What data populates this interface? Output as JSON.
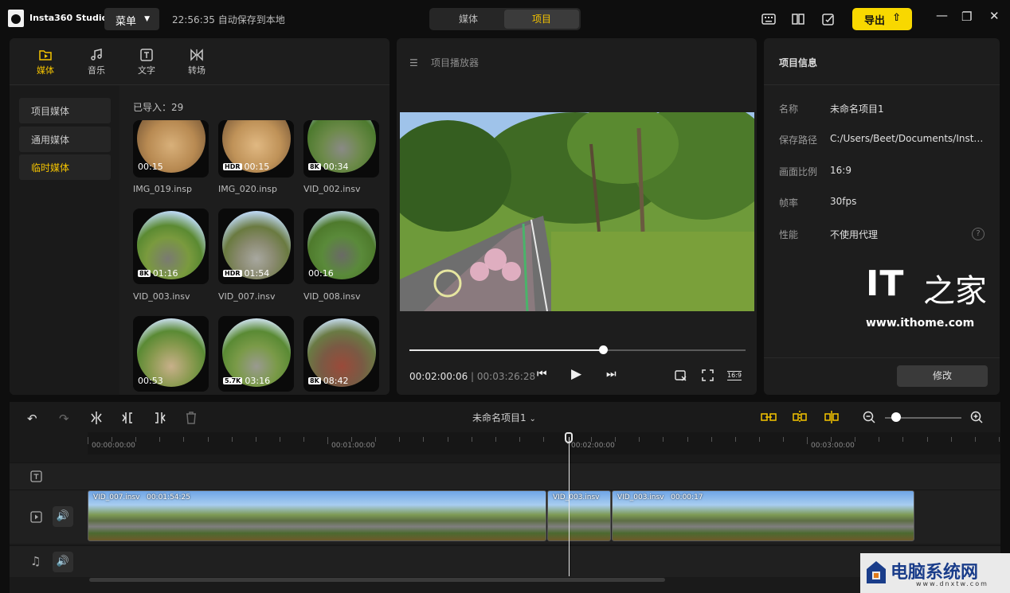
{
  "app": {
    "title": "Insta360 Studio",
    "menu_label": "菜单",
    "autosave": "22:56:35 自动保存到本地"
  },
  "top_toggle": {
    "media": "媒体",
    "project": "项目"
  },
  "toolbar": {
    "export_label": "导出"
  },
  "left_tabs": [
    {
      "label": "媒体",
      "icon": "folder-play-icon"
    },
    {
      "label": "音乐",
      "icon": "music-note-icon"
    },
    {
      "label": "文字",
      "icon": "text-icon"
    },
    {
      "label": "转场",
      "icon": "transition-icon"
    }
  ],
  "side_menu": [
    "项目媒体",
    "通用媒体",
    "临时媒体"
  ],
  "imported_label": "已导入：29",
  "media": [
    {
      "name": "IMG_019.insp",
      "badge": "",
      "duration": "00:15"
    },
    {
      "name": "IMG_020.insp",
      "badge": "HDR",
      "duration": "00:15"
    },
    {
      "name": "VID_002.insv",
      "badge": "8K",
      "duration": "00:34"
    },
    {
      "name": "VID_003.insv",
      "badge": "8K",
      "duration": "01:16"
    },
    {
      "name": "VID_007.insv",
      "badge": "HDR",
      "duration": "01:54"
    },
    {
      "name": "VID_008.insv",
      "badge": "",
      "duration": "00:16"
    },
    {
      "name": "",
      "badge": "",
      "duration": "00:53"
    },
    {
      "name": "",
      "badge": "5.7K",
      "duration": "03:16"
    },
    {
      "name": "",
      "badge": "8K",
      "duration": "08:42"
    }
  ],
  "player": {
    "header": "项目播放器",
    "current": "00:02:00:06",
    "total": "00:03:26:28",
    "progress": 0.578,
    "aspect_icon": "16:9"
  },
  "info": {
    "header": "项目信息",
    "rows": [
      {
        "label": "名称",
        "value": "未命名项目1"
      },
      {
        "label": "保存路径",
        "value": "C:/Users/Beet/Documents/Insta..."
      },
      {
        "label": "画面比例",
        "value": "16:9"
      },
      {
        "label": "帧率",
        "value": "30fps"
      },
      {
        "label": "性能",
        "value": "不使用代理"
      }
    ],
    "modify_label": "修改",
    "watermark_site": "www.ithome.com"
  },
  "timeline": {
    "project_name": "未命名项目1",
    "ruler": [
      "00:00:00:00",
      "00:01:00:00",
      "00:02:00:00",
      "00:03:00:00"
    ],
    "zoom": 0.15,
    "clips": [
      {
        "name": "VID_007.insv",
        "time": "00:01:54:25"
      },
      {
        "name": "VID_003.insv",
        "time": ""
      },
      {
        "name": "VID_003.insv",
        "time": "00:00:17"
      }
    ]
  },
  "watermark2": {
    "text": "电脑系统网",
    "url": "www.dnxtw.com"
  }
}
